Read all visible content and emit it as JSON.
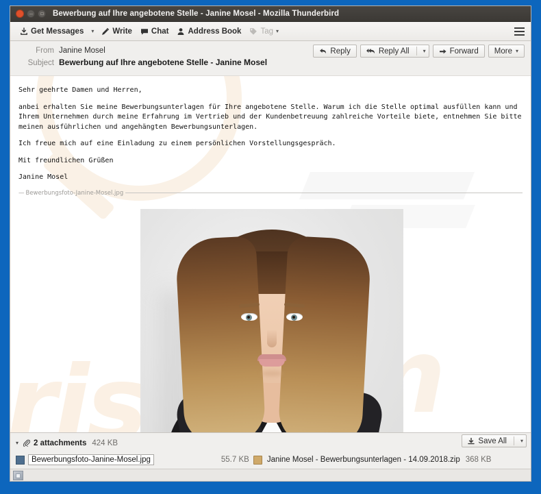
{
  "window": {
    "title": "Bewerbung auf Ihre angebotene Stelle - Janine Mosel - Mozilla Thunderbird",
    "controls": {
      "close": "close-button",
      "minimize": "minimize-button",
      "maximize": "maximize-button"
    },
    "frame_color": "#0d66bd"
  },
  "toolbar": {
    "get_messages": "Get Messages",
    "get_messages_caret": "▾",
    "write": "Write",
    "chat": "Chat",
    "address_book": "Address Book",
    "tag": "Tag",
    "tag_caret": "▾",
    "app_menu": "app-menu"
  },
  "header": {
    "from_label": "From",
    "from_value": "Janine Mosel",
    "subject_label": "Subject",
    "subject_value": "Bewerbung auf Ihre angebotene Stelle - Janine Mosel",
    "actions": {
      "reply": "Reply",
      "reply_all": "Reply All",
      "reply_all_caret": "▾",
      "forward": "Forward",
      "more": "More",
      "more_caret": "▾"
    }
  },
  "message": {
    "greeting": "Sehr geehrte Damen und Herren,",
    "paragraph1": "anbei erhalten Sie meine Bewerbungsunterlagen für Ihre angebotene Stelle. Warum ich die Stelle optimal ausfüllen kann und Ihrem Unternehmen durch meine Erfahrung im Vertrieb und der Kundenbetreuung zahlreiche Vorteile biete, entnehmen Sie bitte meinen ausführlichen und angehängten Bewerbungsunterlagen.",
    "paragraph2": "Ich freue mich auf eine Einladung zu einem persönlichen Vorstellungsgespräch.",
    "closing": "Mit freundlichen Grüßen",
    "signature": "Janine Mosel",
    "inline_attachment_separator": "Bewerbungsfoto-Janine-Mosel.jpg",
    "inline_attachment_dash": "—",
    "inline_image_alt": "Portrait photo of Janine Mosel"
  },
  "watermark": {
    "left_text": "risk",
    "right_text": "m"
  },
  "attachments": {
    "twisty": "▾",
    "count_label": "2 attachments",
    "total_size": "424 KB",
    "save_all": "Save All",
    "save_all_caret": "▾",
    "items": [
      {
        "name": "Bewerbungsfoto-Janine-Mosel.jpg",
        "size": "55.7 KB",
        "type": "image",
        "selected": true
      },
      {
        "name": "Janine Mosel - Bewerbungsunterlagen - 14.09.2018.zip",
        "size": "368 KB",
        "type": "zip",
        "selected": false
      }
    ]
  },
  "statusbar": {
    "icon": "network-status-icon"
  }
}
